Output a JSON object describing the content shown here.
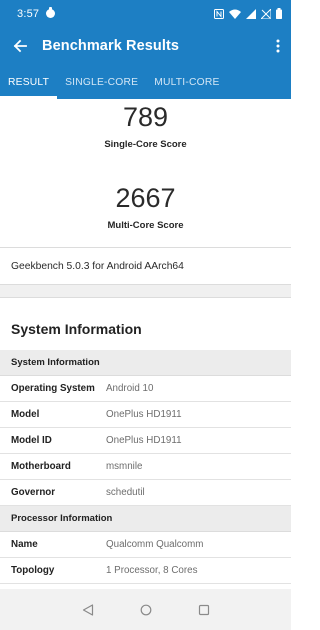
{
  "status_bar": {
    "time": "3:57",
    "icons": [
      "circle-notification-icon",
      "nfc-icon",
      "wifi-icon",
      "signal-icon",
      "no-signal-icon",
      "battery-icon"
    ]
  },
  "app_bar": {
    "title": "Benchmark Results",
    "back_icon": "arrow-left-icon",
    "menu_icon": "more-vert-icon",
    "color": "#1d7fc4"
  },
  "tabs": [
    {
      "label": "RESULT",
      "active": true
    },
    {
      "label": "SINGLE-CORE",
      "active": false
    },
    {
      "label": "MULTI-CORE",
      "active": false
    }
  ],
  "scores": {
    "single_core": {
      "value": "789",
      "label": "Single-Core Score"
    },
    "multi_core": {
      "value": "2667",
      "label": "Multi-Core Score"
    }
  },
  "version_text": "Geekbench 5.0.3 for Android AArch64",
  "system_information": {
    "heading": "System Information",
    "subheader": "System Information",
    "rows": [
      {
        "key": "Operating System",
        "value": "Android 10"
      },
      {
        "key": "Model",
        "value": "OnePlus HD1911"
      },
      {
        "key": "Model ID",
        "value": "OnePlus HD1911"
      },
      {
        "key": "Motherboard",
        "value": "msmnile"
      },
      {
        "key": "Governor",
        "value": "schedutil"
      }
    ]
  },
  "processor_information": {
    "subheader": "Processor Information",
    "rows": [
      {
        "key": "Name",
        "value": "Qualcomm Qualcomm"
      },
      {
        "key": "Topology",
        "value": "1 Processor, 8 Cores"
      }
    ]
  },
  "nav_bar": {
    "icons": [
      "back-triangle-icon",
      "home-circle-icon",
      "recents-square-icon"
    ]
  }
}
